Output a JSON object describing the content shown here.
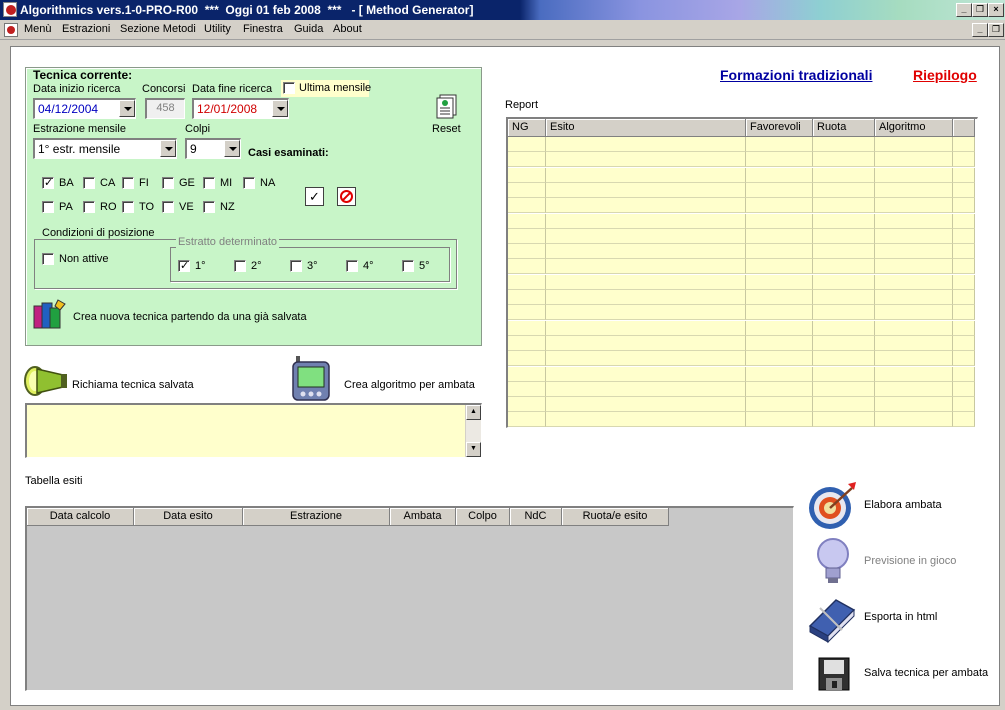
{
  "window": {
    "title": "Algorithmics vers.1-0-PRO-R00  ***  Oggi 01 feb 2008  ***   - [ Method Generator]"
  },
  "menubar": [
    "Menù",
    "Estrazioni",
    "Sezione Metodi",
    "Utility",
    "Finestra",
    "Guida",
    "About"
  ],
  "tecnica": {
    "title": "Tecnica corrente:",
    "data_inizio_label": "Data inizio ricerca",
    "data_inizio_value": "04/12/2004",
    "concorsi_label": "Concorsi",
    "concorsi_value": "458",
    "data_fine_label": "Data fine ricerca",
    "data_fine_value": "12/01/2008",
    "ultima_mensile_label": "Ultima mensile",
    "reset_label": "Reset",
    "estrazione_mensile_label": "Estrazione mensile",
    "estrazione_mensile_value": "1° estr. mensile",
    "colpi_label": "Colpi",
    "colpi_value": "9",
    "casi_label": "Casi esaminati:",
    "ruote": [
      {
        "name": "BA",
        "checked": true
      },
      {
        "name": "CA",
        "checked": false
      },
      {
        "name": "FI",
        "checked": false
      },
      {
        "name": "GE",
        "checked": false
      },
      {
        "name": "MI",
        "checked": false
      },
      {
        "name": "NA",
        "checked": false
      },
      {
        "name": "PA",
        "checked": false
      },
      {
        "name": "RO",
        "checked": false
      },
      {
        "name": "TO",
        "checked": false
      },
      {
        "name": "VE",
        "checked": false
      },
      {
        "name": "NZ",
        "checked": false
      }
    ],
    "condizioni_label": "Condizioni di posizione",
    "non_attive_label": "Non attive",
    "estratto_label": "Estratto determinato",
    "estratti": [
      {
        "name": "1°",
        "checked": true
      },
      {
        "name": "2°",
        "checked": false
      },
      {
        "name": "3°",
        "checked": false
      },
      {
        "name": "4°",
        "checked": false
      },
      {
        "name": "5°",
        "checked": false
      }
    ],
    "crea_nuova_label": "Crea nuova tecnica partendo da una già salvata"
  },
  "actions": {
    "richiama_label": "Richiama tecnica salvata",
    "crea_algoritmo_label": "Crea algoritmo per ambata"
  },
  "links": {
    "formazioni": "Formazioni tradizionali",
    "riepilogo": "Riepilogo"
  },
  "report": {
    "label": "Report",
    "columns": [
      "NG",
      "Esito",
      "Favorevoli",
      "Ruota",
      "Algoritmo"
    ]
  },
  "tabella": {
    "label": "Tabella esiti",
    "columns": [
      "Data calcolo",
      "Data esito",
      "Estrazione",
      "Ambata",
      "Colpo",
      "NdC",
      "Ruota/e esito"
    ]
  },
  "side_buttons": {
    "elabora": "Elabora ambata",
    "previsione": "Previsione in gioco",
    "esporta": "Esporta in html",
    "salva": "Salva tecnica per ambata"
  },
  "colors": {
    "panel_green": "#c8f5c8",
    "field_yellow": "#ffffcc",
    "link_blue": "#0000a0",
    "link_red": "#e00000",
    "date_blue": "#0000c0",
    "date_red": "#d00000"
  }
}
